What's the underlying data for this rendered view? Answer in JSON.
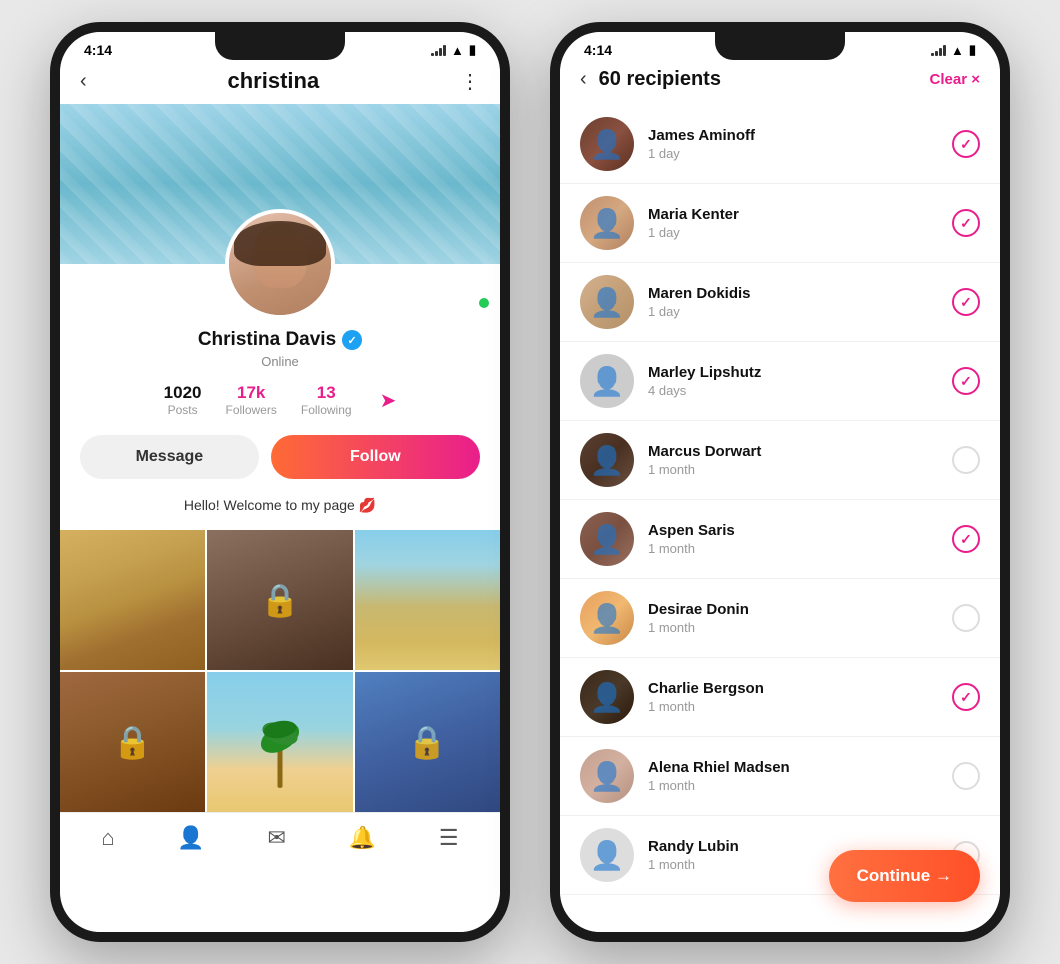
{
  "phone1": {
    "status_time": "4:14",
    "header": {
      "back_label": "‹",
      "title": "christina",
      "more_label": "⋮"
    },
    "profile": {
      "name": "Christina Davis",
      "verified": true,
      "status": "Online",
      "stats": {
        "posts_value": "1020",
        "posts_label": "Posts",
        "followers_value": "17k",
        "followers_label": "Followers",
        "following_value": "13",
        "following_label": "Following"
      },
      "message_btn": "Message",
      "follow_btn": "Follow",
      "bio": "Hello! Welcome to my page 💋"
    }
  },
  "phone2": {
    "status_time": "4:14",
    "header": {
      "back_label": "‹",
      "title": "60 recipients",
      "clear_label": "Clear ×"
    },
    "recipients": [
      {
        "name": "James Aminoff",
        "time": "1 day",
        "checked": true,
        "avatar": "av-james"
      },
      {
        "name": "Maria Kenter",
        "time": "1 day",
        "checked": true,
        "avatar": "av-maria"
      },
      {
        "name": "Maren Dokidis",
        "time": "1 day",
        "checked": true,
        "avatar": "av-maren"
      },
      {
        "name": "Marley Lipshutz",
        "time": "4 days",
        "checked": true,
        "avatar": "av-marley"
      },
      {
        "name": "Marcus Dorwart",
        "time": "1 month",
        "checked": false,
        "avatar": "av-marcus"
      },
      {
        "name": "Aspen Saris",
        "time": "1 month",
        "checked": true,
        "avatar": "av-aspen"
      },
      {
        "name": "Desirae Donin",
        "time": "1 month",
        "checked": false,
        "avatar": "av-desirae"
      },
      {
        "name": "Charlie Bergson",
        "time": "1 month",
        "checked": true,
        "avatar": "av-charlie"
      },
      {
        "name": "Alena Rhiel Madsen",
        "time": "1 month",
        "checked": false,
        "avatar": "av-alena"
      },
      {
        "name": "Randy Lubin",
        "time": "1 month",
        "checked": false,
        "avatar": "av-randy"
      }
    ],
    "continue_btn": "Continue →"
  }
}
